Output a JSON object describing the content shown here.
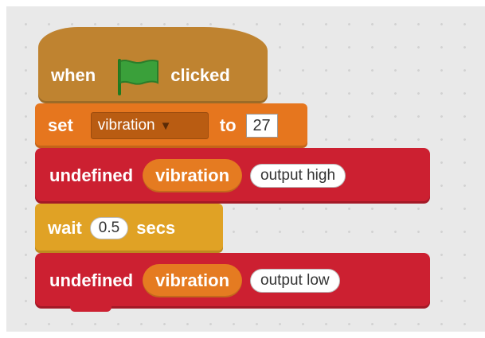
{
  "script": {
    "hat": {
      "when": "when",
      "flag_icon": "green-flag-icon",
      "clicked": "clicked"
    },
    "set": {
      "set": "set",
      "variable": "vibration",
      "to": "to",
      "value": "27"
    },
    "output_high": {
      "label": "undefined",
      "pin": "vibration",
      "state": "output high"
    },
    "wait": {
      "wait": "wait",
      "secs_value": "0.5",
      "secs": "secs"
    },
    "output_low": {
      "label": "undefined",
      "pin": "vibration",
      "state": "output low"
    }
  },
  "colors": {
    "events": "#bf8330",
    "data": "#e6761e",
    "control": "#e0a225",
    "extension": "#cc2031",
    "flag": "#2ca02c"
  }
}
